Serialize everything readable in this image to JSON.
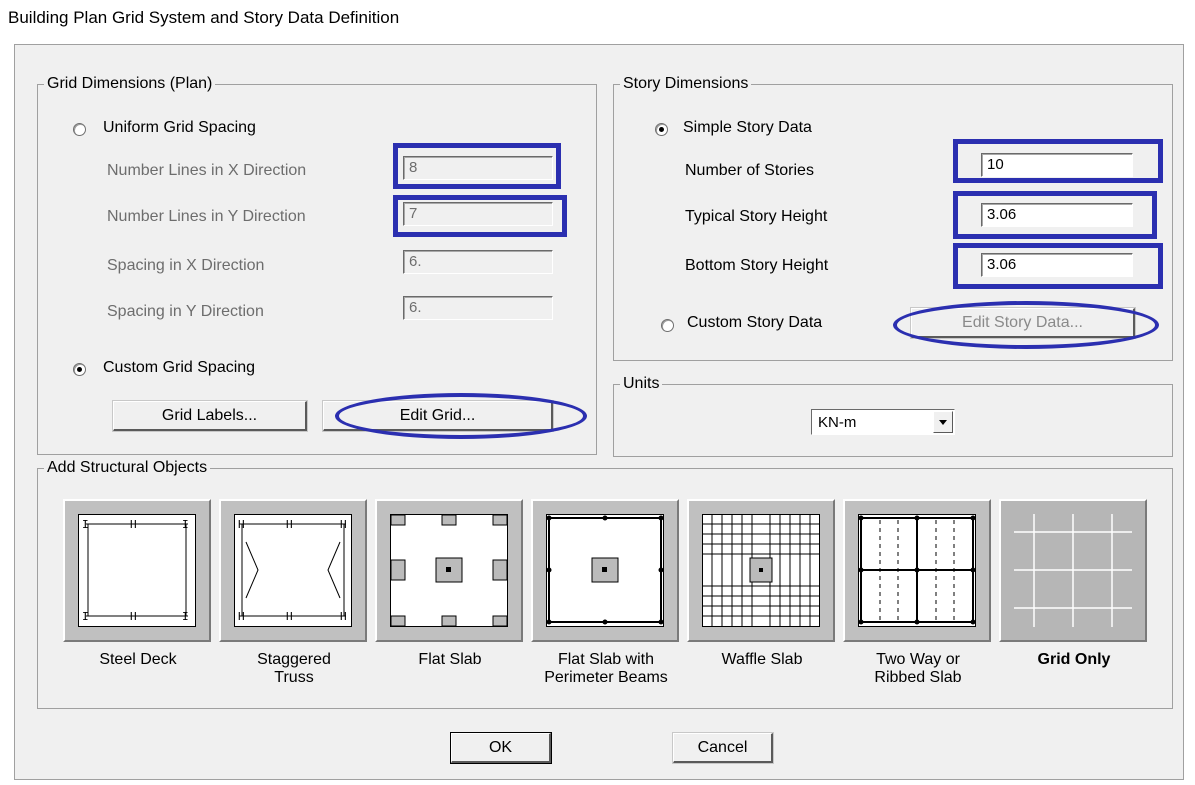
{
  "window": {
    "title": "Building Plan Grid System and Story Data Definition"
  },
  "grid": {
    "legend": "Grid Dimensions (Plan)",
    "uniform_label": "Uniform Grid Spacing",
    "uniform_selected": false,
    "rows": [
      {
        "label": "Number Lines in X Direction",
        "value": "8"
      },
      {
        "label": "Number Lines in Y Direction",
        "value": "7"
      },
      {
        "label": "Spacing in X Direction",
        "value": "6."
      },
      {
        "label": "Spacing in Y Direction",
        "value": "6."
      }
    ],
    "custom_label": "Custom Grid Spacing",
    "custom_selected": true,
    "grid_labels_button": "Grid Labels...",
    "edit_grid_button": "Edit Grid..."
  },
  "story": {
    "legend": "Story Dimensions",
    "simple_label": "Simple Story Data",
    "simple_selected": true,
    "rows": [
      {
        "label": "Number of Stories",
        "value": "10"
      },
      {
        "label": "Typical Story Height",
        "value": "3.06"
      },
      {
        "label": "Bottom Story Height",
        "value": "3.06"
      }
    ],
    "custom_label": "Custom Story Data",
    "custom_selected": false,
    "edit_story_button": "Edit Story Data..."
  },
  "units": {
    "legend": "Units",
    "selected": "KN-m"
  },
  "objects": {
    "legend": "Add Structural Objects",
    "items": [
      {
        "label": "Steel Deck",
        "icon": "steel-deck-icon"
      },
      {
        "label": "Staggered\nTruss",
        "icon": "staggered-truss-icon"
      },
      {
        "label": "Flat Slab",
        "icon": "flat-slab-icon"
      },
      {
        "label": "Flat Slab with\nPerimeter Beams",
        "icon": "flat-slab-perimeter-beams-icon"
      },
      {
        "label": "Waffle Slab",
        "icon": "waffle-slab-icon"
      },
      {
        "label": "Two Way or\nRibbed Slab",
        "icon": "two-way-ribbed-slab-icon"
      },
      {
        "label": "Grid Only",
        "icon": "grid-only-icon",
        "selected": true
      }
    ]
  },
  "buttons": {
    "ok": "OK",
    "cancel": "Cancel"
  },
  "colors": {
    "highlight": "#2b2fb0",
    "dialog_bg": "#f0f0f0"
  }
}
